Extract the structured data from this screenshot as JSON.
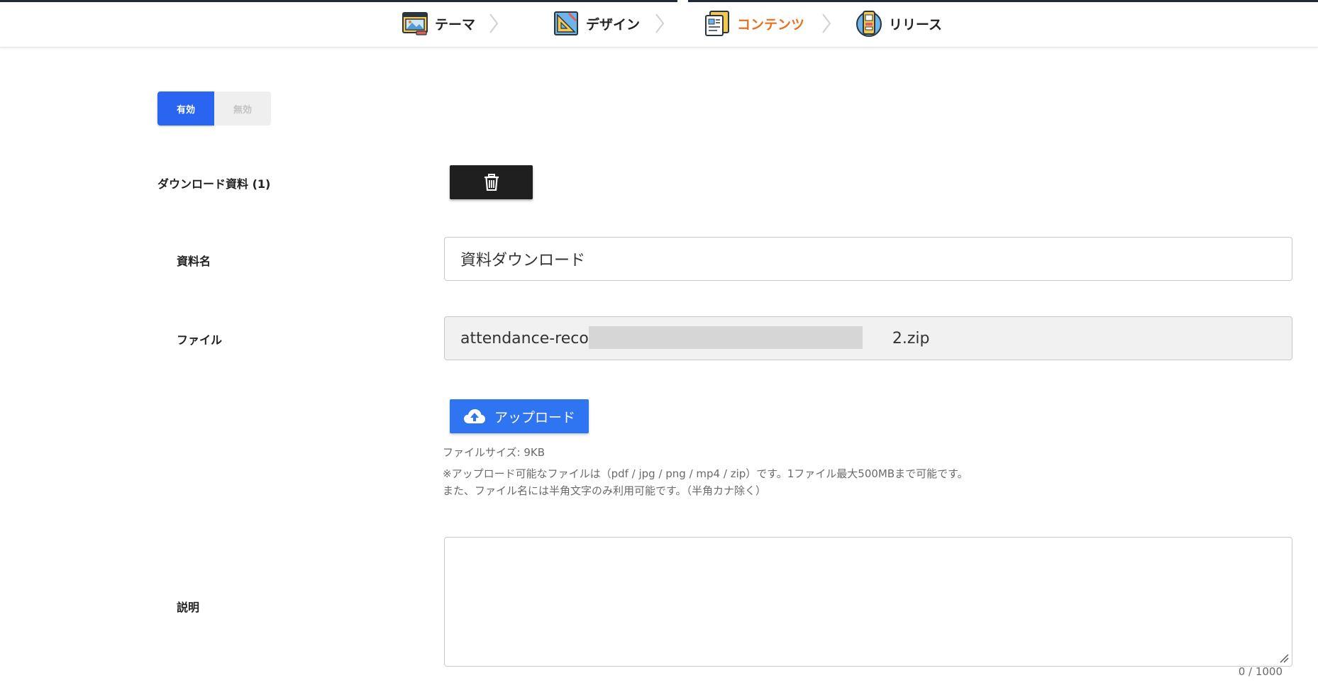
{
  "stepper": {
    "steps": [
      {
        "label": "テーマ",
        "icon": "theme-image-icon",
        "active": false
      },
      {
        "label": "デザイン",
        "icon": "design-ruler-icon",
        "active": false
      },
      {
        "label": "コンテンツ",
        "icon": "content-document-icon",
        "active": true
      },
      {
        "label": "リリース",
        "icon": "release-mobile-icon",
        "active": false
      }
    ],
    "active_color": "#e8711b"
  },
  "toggle": {
    "enabled_label": "有効",
    "disabled_label": "無効",
    "selected": "有効"
  },
  "download_section": {
    "title": "ダウンロード資料 (1)",
    "delete_icon": "trash-icon"
  },
  "material_name": {
    "label": "資料名",
    "value": "資料ダウンロード"
  },
  "file": {
    "label": "ファイル",
    "value_prefix": "attendance-record-s",
    "value_suffix": "2.zip"
  },
  "upload": {
    "label": "アップロード",
    "icon": "cloud-upload-icon"
  },
  "file_size": "ファイルサイズ: 9KB",
  "upload_notes": [
    "※アップロード可能なファイルは（pdf / jpg / png / mp4 / zip）です。1ファイル最大500MBまで可能です。",
    "また、ファイル名には半角文字のみ利用可能です。（半角カナ除く）"
  ],
  "description": {
    "label": "説明",
    "value": "",
    "counter": "0 / 1000"
  },
  "colors": {
    "primary_blue": "#2965f1",
    "upload_blue": "#2f74f0",
    "dark_button": "#1f1f1f"
  }
}
